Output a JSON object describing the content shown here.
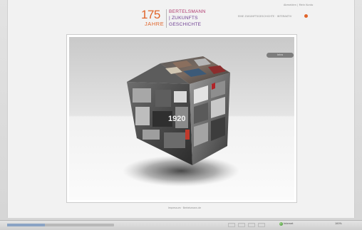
{
  "header": {
    "user_link": "Abmelden | Mein Konto",
    "logo": {
      "number": "175",
      "jahre": "JAHRE",
      "line1": "BERTELSMANN",
      "line2": "| ZUKUNFTS",
      "line3": "GESCHICHTE"
    },
    "nav_text": "EINE ZUKUNFTSGESCHICHTE · INTERAKTIV",
    "accent_color": "#e0642a"
  },
  "stage": {
    "back_button_label": "Intro",
    "cube_year": "1920",
    "cube_icon": "photo-cube-icon"
  },
  "footer": {
    "links": "Impressum · Bertelsmann.de"
  },
  "statusbar": {
    "zone": "Internet",
    "zoom": "100%",
    "progress": 0.35
  }
}
